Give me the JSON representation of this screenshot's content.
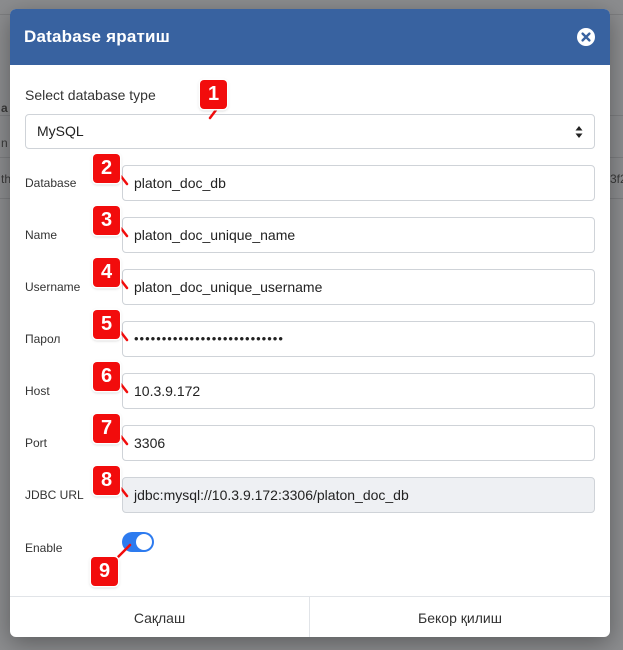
{
  "background": {
    "fragments": [
      "a",
      "n",
      "th",
      "3f2"
    ]
  },
  "modal": {
    "title": "Database яратиш",
    "close_icon": "close-circle-icon"
  },
  "db_type": {
    "label": "Select database type",
    "selected": "MySQL"
  },
  "fields": [
    {
      "label": "Database",
      "value": "platon_doc_db"
    },
    {
      "label": "Name",
      "value": "platon_doc_unique_name"
    },
    {
      "label": "Username",
      "value": "platon_doc_unique_username"
    },
    {
      "label": "Парол",
      "value": "•••••••••••••••••••••••••••"
    },
    {
      "label": "Host",
      "value": "10.3.9.172"
    },
    {
      "label": "Port",
      "value": "3306"
    },
    {
      "label": "JDBC URL",
      "value": "jdbc:mysql://10.3.9.172:3306/platon_doc_db"
    }
  ],
  "enable": {
    "label": "Enable",
    "state": true
  },
  "footer": {
    "save_label": "Сақлаш",
    "cancel_label": "Бекор қилиш"
  },
  "annotations": [
    "1",
    "2",
    "3",
    "4",
    "5",
    "6",
    "7",
    "8",
    "9"
  ],
  "colors": {
    "header": "#3862a0",
    "toggle_on": "#2d7bef",
    "badge": "#f20c0c",
    "readonly_bg": "#eef0f3"
  }
}
